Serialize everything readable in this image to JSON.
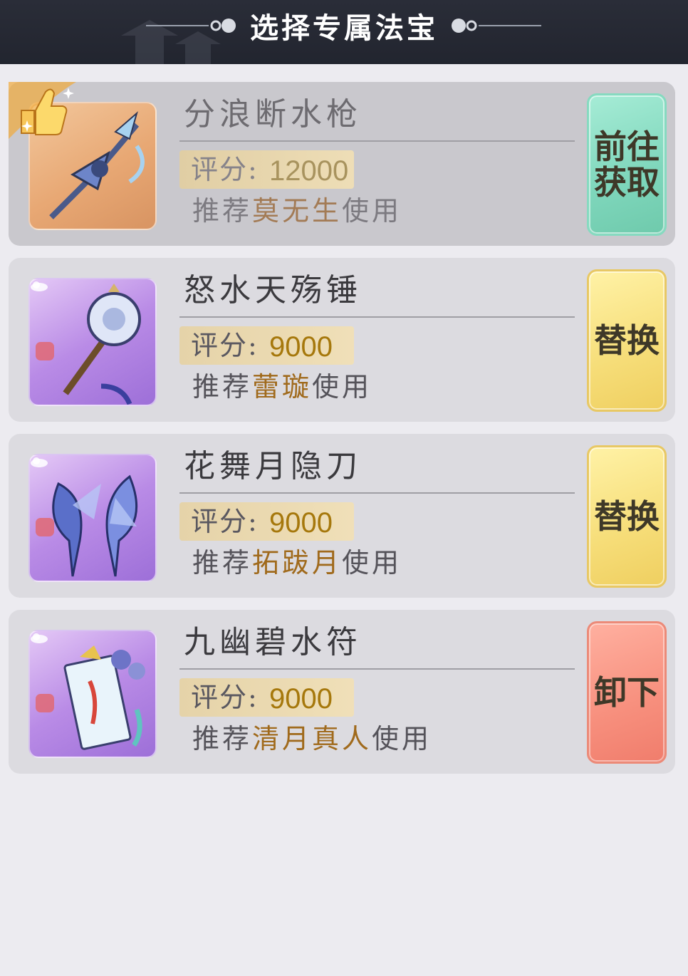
{
  "header": {
    "title": "选择专属法宝"
  },
  "score_label": "评分:",
  "items": [
    {
      "name": "分浪断水枪",
      "score": "12000",
      "rec_prefix": "推荐",
      "hero": "莫无生",
      "rec_suffix": "使用",
      "action": "前往获取",
      "action_color": "#7ed6bb",
      "frame": "gold",
      "selected": true,
      "badge_icon": "thumbs-up-icon"
    },
    {
      "name": "怒水天殇锤",
      "score": "9000",
      "rec_prefix": "推荐",
      "hero": "蕾璇",
      "rec_suffix": "使用",
      "action": "替换",
      "action_color": "#f6dd78",
      "frame": "purple",
      "selected": false
    },
    {
      "name": "花舞月隐刀",
      "score": "9000",
      "rec_prefix": "推荐",
      "hero": "拓跋月",
      "rec_suffix": "使用",
      "action": "替换",
      "action_color": "#f6dd78",
      "frame": "purple",
      "selected": false
    },
    {
      "name": "九幽碧水符",
      "score": "9000",
      "rec_prefix": "推荐",
      "hero": "清月真人",
      "rec_suffix": "使用",
      "action": "卸下",
      "action_color": "#f78f7d",
      "frame": "purple",
      "selected": false
    }
  ]
}
